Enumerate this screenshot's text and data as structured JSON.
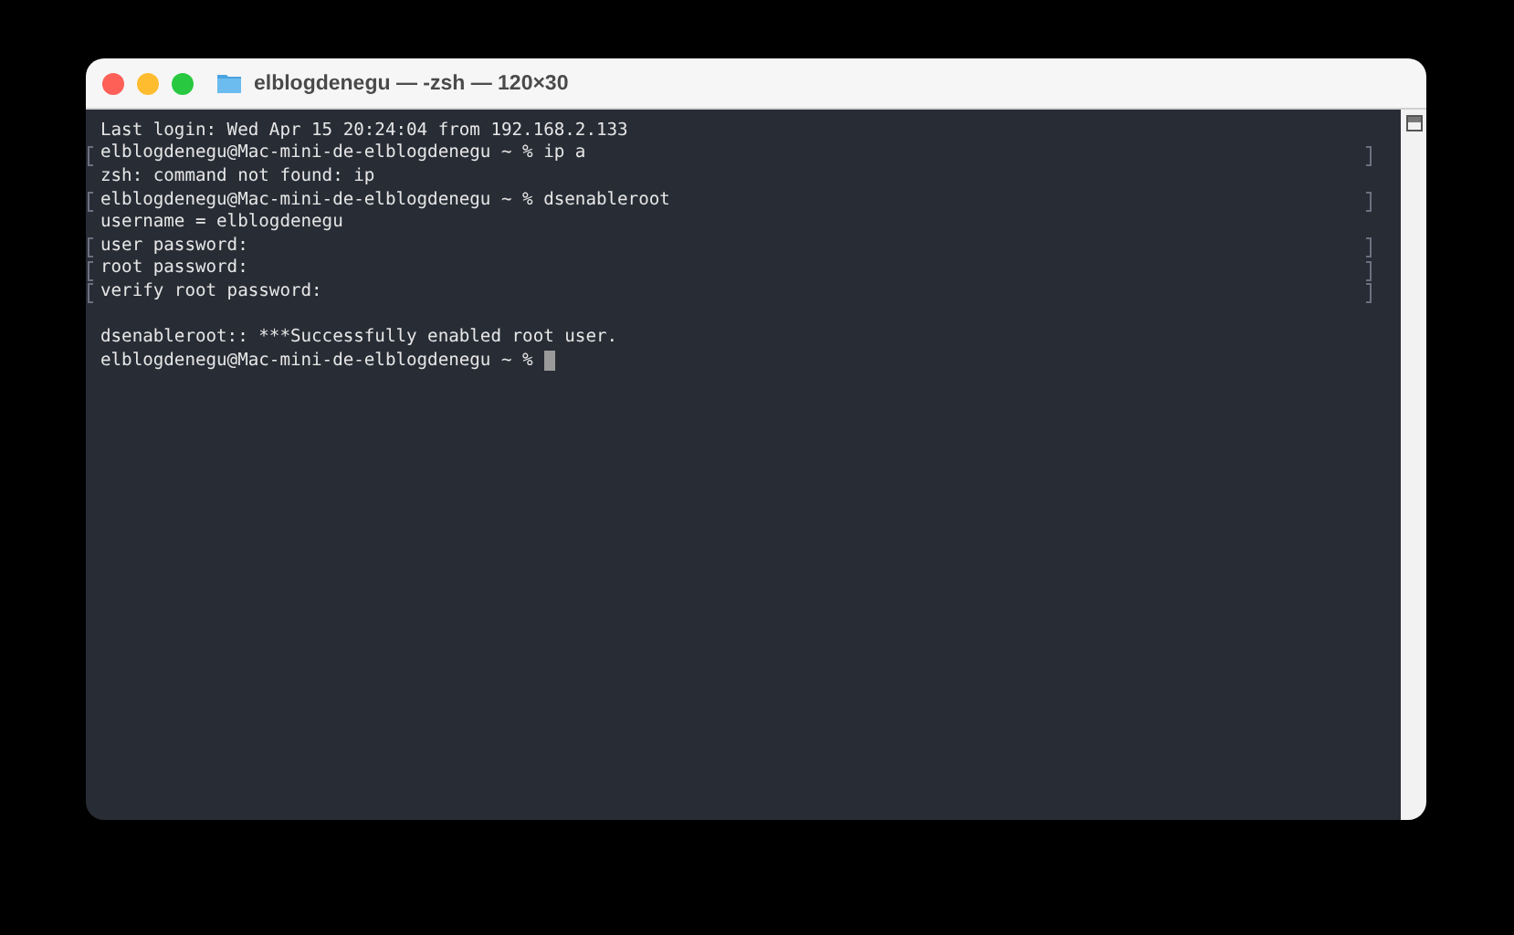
{
  "window": {
    "title": "elblogdenegu — -zsh — 120×30"
  },
  "terminal": {
    "lines": [
      {
        "text": "Last login: Wed Apr 15 20:24:04 from 192.168.2.133",
        "marked": false,
        "cursor": false
      },
      {
        "text": "elblogdenegu@Mac-mini-de-elblogdenegu ~ % ip a",
        "marked": true,
        "cursor": false
      },
      {
        "text": "zsh: command not found: ip",
        "marked": false,
        "cursor": false
      },
      {
        "text": "elblogdenegu@Mac-mini-de-elblogdenegu ~ % dsenableroot",
        "marked": true,
        "cursor": false
      },
      {
        "text": "username = elblogdenegu",
        "marked": false,
        "cursor": false
      },
      {
        "text": "user password:",
        "marked": true,
        "cursor": false
      },
      {
        "text": "root password:",
        "marked": true,
        "cursor": false
      },
      {
        "text": "verify root password:",
        "marked": true,
        "cursor": false
      },
      {
        "text": "dsenableroot:: ***Successfully enabled root user.",
        "marked": false,
        "cursor": false,
        "blank_before": true
      },
      {
        "text": "elblogdenegu@Mac-mini-de-elblogdenegu ~ %",
        "marked": false,
        "cursor": true
      }
    ]
  }
}
